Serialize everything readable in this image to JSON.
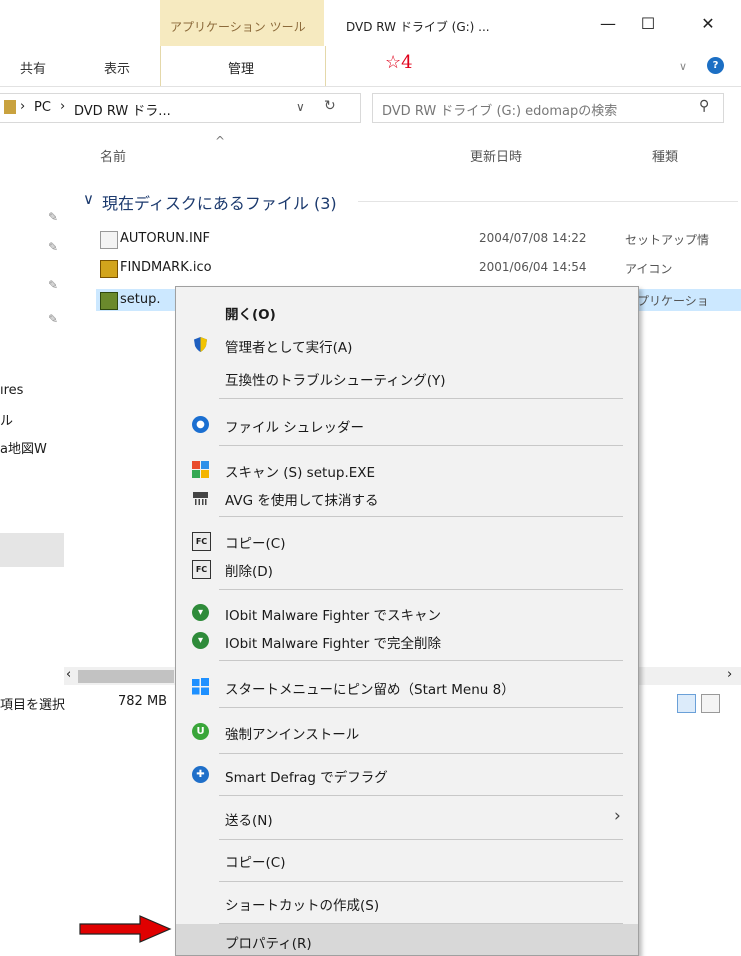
{
  "window": {
    "tool_tab": "アプリケーション ツール",
    "title": "DVD RW ドライブ (G:) ...",
    "minimize": "—",
    "maximize": "☐",
    "close": "✕"
  },
  "ribbon": {
    "tabs": [
      "共有",
      "表示",
      "管理"
    ],
    "annotation": "☆4",
    "expand_icon": "chevron-down-icon",
    "help_icon": "help-icon"
  },
  "address": {
    "path": [
      "PC",
      "DVD RW ドラ..."
    ],
    "search_placeholder": "DVD RW ドライブ (G:) edomapの検索"
  },
  "columns": {
    "name": "名前",
    "date": "更新日時",
    "type": "種類"
  },
  "group": {
    "label": "現在ディスクにあるファイル (3)"
  },
  "files": [
    {
      "name": "AUTORUN.INF",
      "date": "2004/07/08 14:22",
      "type": "セットアップ情"
    },
    {
      "name": "FINDMARK.ico",
      "date": "2001/06/04 14:54",
      "type": "アイコン"
    },
    {
      "name": "setup.",
      "date": "",
      "type": "アプリケーショ"
    }
  ],
  "nav_pane": {
    "items": [
      "ıres",
      "ル",
      "a地図W"
    ]
  },
  "status": {
    "text": "項目を選択",
    "size": "782 MB"
  },
  "context_menu": {
    "items": [
      {
        "label": "開く(O)",
        "bold": true,
        "icon": ""
      },
      {
        "label": "管理者として実行(A)",
        "icon": "uac-shield-icon"
      },
      {
        "label": "互換性のトラブルシューティング(Y)",
        "icon": ""
      },
      {
        "label": "ファイル シュレッダー",
        "icon": "file-shredder-icon"
      },
      {
        "label": "スキャン (S) setup.EXE",
        "icon": "avg-scan-icon"
      },
      {
        "label": "AVG を使用して抹消する",
        "icon": "shredder-icon"
      },
      {
        "label": "コピー(C)",
        "icon": "fastcopy-icon"
      },
      {
        "label": "削除(D)",
        "icon": "fastcopy-icon"
      },
      {
        "label": "IObit Malware Fighter でスキャン",
        "icon": "iobit-shield-icon"
      },
      {
        "label": "IObit Malware Fighter で完全削除",
        "icon": "iobit-shield-icon"
      },
      {
        "label": "スタートメニューにピン留め（Start Menu 8）",
        "icon": "windows-icon"
      },
      {
        "label": "強制アンインストール",
        "icon": "iobit-uninstaller-icon"
      },
      {
        "label": "Smart Defrag でデフラグ",
        "icon": "smart-defrag-icon"
      },
      {
        "label": "送る(N)",
        "icon": "",
        "submenu": true
      },
      {
        "label": "コピー(C)",
        "icon": ""
      },
      {
        "label": "ショートカットの作成(S)",
        "icon": ""
      },
      {
        "label": "プロパティ(R)",
        "icon": "",
        "highlighted": true
      }
    ]
  },
  "colors": {
    "tool_tab_bg": "#f6eac0",
    "selection": "#cce8ff",
    "menu_bg": "#f2f2f2",
    "annotation_red": "#e0001a",
    "arrow_red": "#e00000"
  }
}
